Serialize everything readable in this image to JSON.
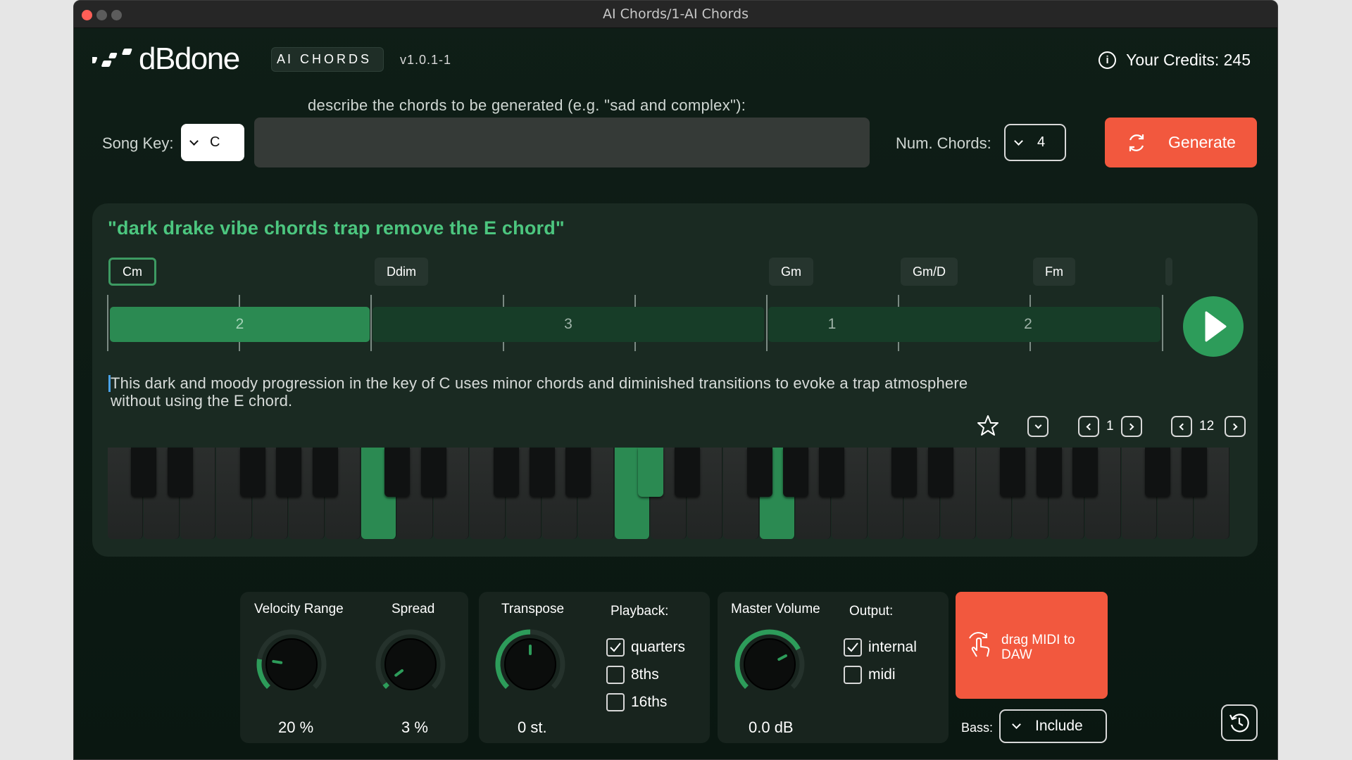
{
  "window": {
    "title": "AI Chords/1-AI Chords"
  },
  "header": {
    "brand": "dBdone",
    "badge_ai": "AI",
    "badge_chords": "CHORDS",
    "version": "v1.0.1-1",
    "credits": "Your Credits: 245",
    "info_icon": "info-icon"
  },
  "form": {
    "prompt_label": "describe the chords to be generated (e.g. \"sad and complex\"):",
    "prompt_value": "",
    "song_key_label": "Song Key:",
    "song_key_value": "C",
    "num_chords_label": "Num. Chords:",
    "num_chords_value": "4",
    "generate_label": "Generate",
    "generate_icon": "refresh-icon"
  },
  "result": {
    "quote": "\"dark drake vibe chords trap remove the E chord\"",
    "chords": [
      {
        "name": "Cm",
        "selected": true
      },
      {
        "name": "Ddim",
        "selected": false
      },
      {
        "name": "Gm",
        "selected": false
      },
      {
        "name": "Gm/D",
        "selected": false
      },
      {
        "name": "Fm",
        "selected": false
      }
    ],
    "bars": [
      "2",
      "3",
      "1",
      "2"
    ],
    "description": "This dark and moody progression in the key of C uses minor chords and diminished transitions to evoke a trap atmosphere without using the E chord.",
    "variation_index": "1",
    "total_variations": "12",
    "active_keys": [
      "key-white-7",
      "key-black-10",
      "key-white-14",
      "key-white-18"
    ]
  },
  "controls": {
    "velocity_range": {
      "title": "Velocity Range",
      "value": "20 %",
      "fraction": 0.2
    },
    "spread": {
      "title": "Spread",
      "value": "3 %",
      "fraction": 0.03
    },
    "transpose": {
      "title": "Transpose",
      "value": "0 st.",
      "fraction": 0.5
    },
    "playback": {
      "title": "Playback:",
      "options": [
        {
          "label": "quarters",
          "checked": true
        },
        {
          "label": "8ths",
          "checked": false
        },
        {
          "label": "16ths",
          "checked": false
        }
      ]
    },
    "master_volume": {
      "title": "Master Volume",
      "value": "0.0 dB",
      "fraction": 0.73
    },
    "output": {
      "title": "Output:",
      "options": [
        {
          "label": "internal",
          "checked": true
        },
        {
          "label": "midi",
          "checked": false
        }
      ]
    },
    "drag_label": "drag MIDI to DAW",
    "bass_label": "Bass:",
    "bass_value": "Include"
  },
  "colors": {
    "accent_green": "#2d9c5a",
    "accent_orange": "#f2583e",
    "quote_green": "#4cc67f",
    "background": "#0f1e17"
  }
}
